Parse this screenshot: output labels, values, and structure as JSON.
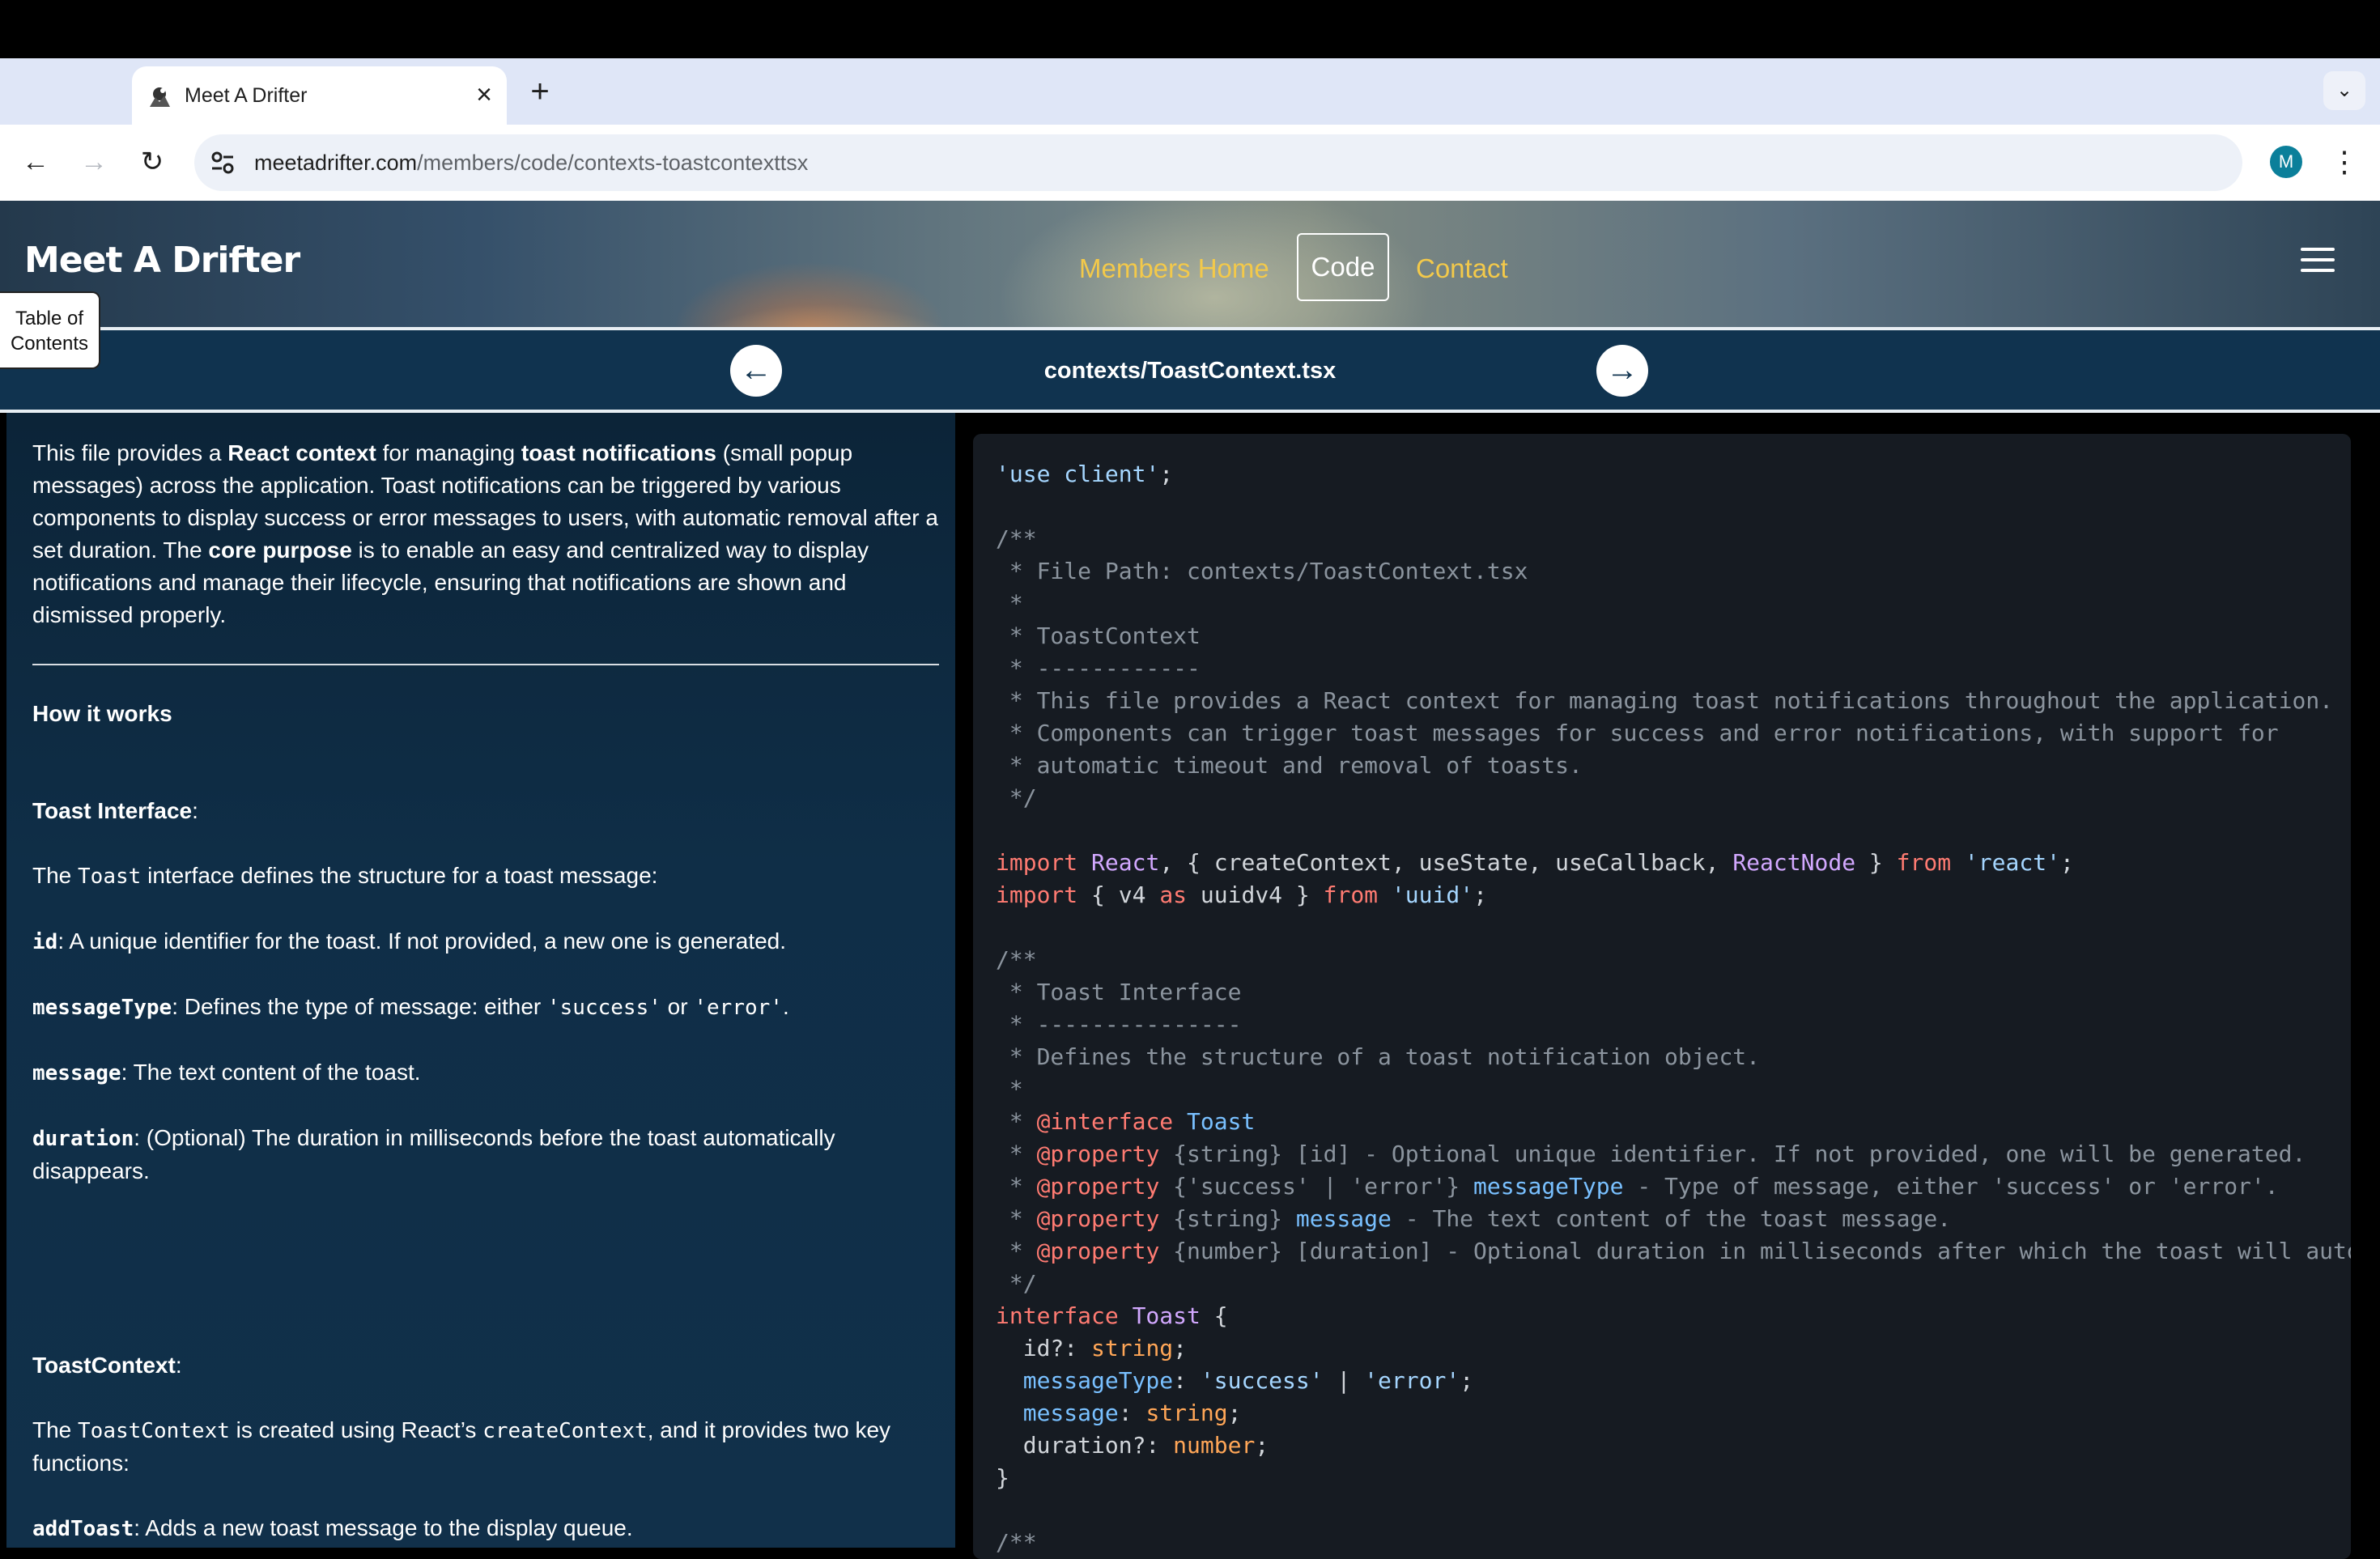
{
  "browser": {
    "tab_title": "Meet A Drifter",
    "url_domain": "meetadrifter.com",
    "url_path": "/members/code/contexts-toastcontexttsx",
    "avatar_letter": "M"
  },
  "site": {
    "brand": "Meet A Drifter",
    "nav": {
      "home": "Members Home",
      "code": "Code",
      "contact": "Contact"
    },
    "toc_line1": "Table of",
    "toc_line2": "Contents",
    "file_title": "contexts/ToastContext.tsx"
  },
  "explanation": {
    "intro": {
      "a": "This file provides a ",
      "b": "React context",
      "c": " for managing ",
      "d": "toast notifications",
      "e": " (small popup messages) across the application. Toast notifications can be triggered by various components to display success or error messages to users, with automatic removal after a set duration. The ",
      "f": "core purpose",
      "g": " is to enable an easy and centralized way to display notifications and manage their lifecycle, ensuring that notifications are shown and dismissed properly."
    },
    "how_it_works": "How it works",
    "toast_interface_heading": "Toast Interface",
    "colon": ":",
    "ti_line_a": "The ",
    "ti_code": "Toast",
    "ti_line_b": " interface defines the structure for a toast message:",
    "id_key": "id",
    "id_desc": ": A unique identifier for the toast. If not provided, a new one is generated.",
    "mt_key": "messageType",
    "mt_desc_a": ": Defines the type of message: either ",
    "mt_success": "'success'",
    "mt_or": " or ",
    "mt_error": "'error'",
    "mt_end": ".",
    "msg_key": "message",
    "msg_desc": ": The text content of the toast.",
    "dur_key": "duration",
    "dur_desc": ": (Optional) The duration in milliseconds before the toast automatically disappears.",
    "tc_heading": "ToastContext",
    "tc_a": "The ",
    "tc_code": "ToastContext",
    "tc_b": " is created using React’s ",
    "tc_code2": "createContext",
    "tc_c": ", and it provides two key functions:",
    "add_key": "addToast",
    "add_desc": ": Adds a new toast message to the display queue."
  },
  "code": {
    "l1": "'use client'",
    "l1_end": ";",
    "l3": "/**",
    "l4": " * File Path: contexts/ToastContext.tsx",
    "l5": " *",
    "l6": " * ToastContext",
    "l7": " * ------------",
    "l8": " * This file provides a React context for managing toast notifications throughout the application.",
    "l9": " * Components can trigger toast messages for success and error notifications, with support for",
    "l10": " * automatic timeout and removal of toasts.",
    "l11": " */",
    "imp": "import",
    "l13_a": " React",
    "l13_b": ", { createContext, useState, useCallback, ",
    "l13_type": "ReactNode",
    "l13_c": " } ",
    "from": "from",
    "l13_str": "'react'",
    "semi": ";",
    "l14_a": " { v4 ",
    "as": "as",
    "l14_b": " uuidv4 } ",
    "l14_str": "'uuid'",
    "l16": "/**",
    "l17": " * Toast Interface",
    "l18": " * ---------------",
    "l19": " * Defines the structure of a toast notification object.",
    "l20": " *",
    "star": " * ",
    "at_interface": "@interface",
    "toast_name": "Toast",
    "at_property": "@property",
    "l22_type": "{string}",
    "l22_rest": " [id] - Optional unique identifier. If not provided, one will be generated.",
    "l23_type_a": "{'success' | 'error'}",
    "l23_name": "messageType",
    "l23_rest": " - Type of message, either 'success' or 'error'.",
    "l24_type": "{string}",
    "l24_name": "message",
    "l24_rest": " - The text content of the toast message.",
    "l25_type": "{number}",
    "l25_rest": " [duration] - Optional duration in milliseconds after which the toast will automatically be removed.",
    "l26": " */",
    "interface_kw": "interface",
    "l27_name": "Toast",
    "l27_end": " {",
    "l28_a": "  id?: ",
    "string_kw": "string",
    "l29_key": "messageType",
    "l29_colon": ": ",
    "l29_s1": "'success'",
    "l29_pipe": " | ",
    "l29_s2": "'error'",
    "l30_key": "message",
    "l31_a": "  duration?: ",
    "number_kw": "number",
    "l32": "}",
    "l34": "/**"
  }
}
